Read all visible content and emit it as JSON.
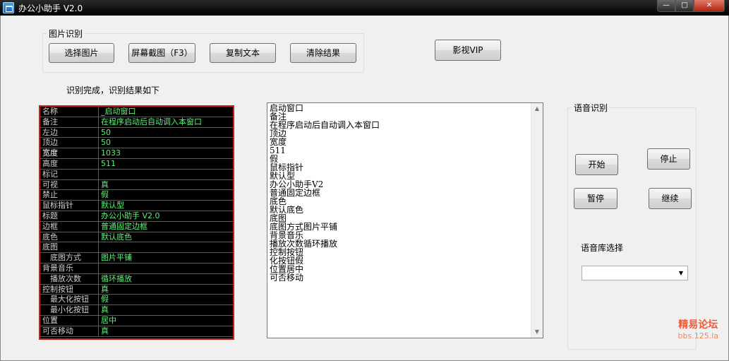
{
  "window": {
    "title": "办公小助手 V2.0",
    "minimize_glyph": "—",
    "maximize_glyph": "□",
    "close_glyph": "✕"
  },
  "image_group": {
    "title": "图片识别",
    "buttons": [
      "选择图片",
      "屏幕截图（F3）",
      "复制文本",
      "清除结果"
    ]
  },
  "vip_button": "影视VIP",
  "status_text": "识别完成，识别结果如下",
  "properties": [
    {
      "name": "名称",
      "value": "_启动窗口",
      "indent": false
    },
    {
      "name": "备注",
      "value": "在程序启动后自动调入本窗口",
      "indent": false
    },
    {
      "name": "左边",
      "value": "50",
      "indent": false
    },
    {
      "name": "顶边",
      "value": "50",
      "indent": false
    },
    {
      "name": "宽度",
      "value": "1033",
      "indent": false
    },
    {
      "name": "高度",
      "value": "511",
      "indent": false
    },
    {
      "name": "标记",
      "value": "",
      "indent": false
    },
    {
      "name": "可视",
      "value": "真",
      "indent": false
    },
    {
      "name": "禁止",
      "value": "假",
      "indent": false
    },
    {
      "name": "鼠标指针",
      "value": "默认型",
      "indent": false
    },
    {
      "name": "标题",
      "value": "办公小助手 V2.0",
      "indent": false
    },
    {
      "name": "边框",
      "value": "普通固定边框",
      "indent": false
    },
    {
      "name": "底色",
      "value": "默认底色",
      "indent": false
    },
    {
      "name": "底图",
      "value": "",
      "indent": false
    },
    {
      "name": "底图方式",
      "value": "图片平铺",
      "indent": true
    },
    {
      "name": "背景音乐",
      "value": "",
      "indent": false
    },
    {
      "name": "播放次数",
      "value": "循环播放",
      "indent": true
    },
    {
      "name": "控制按钮",
      "value": "真",
      "indent": false
    },
    {
      "name": "最大化按钮",
      "value": "假",
      "indent": true
    },
    {
      "name": "最小化按钮",
      "value": "真",
      "indent": true
    },
    {
      "name": "位置",
      "value": "居中",
      "indent": false
    },
    {
      "name": "可否移动",
      "value": "真",
      "indent": false
    }
  ],
  "result_lines": [
    "启动窗口",
    "备注",
    "在程序启动后自动调入本窗口",
    "顶边",
    "宽度",
    "511",
    "假",
    "鼠标指针",
    "默认型",
    "办公小助手V2",
    "普通固定边框",
    "底色",
    "默认底色",
    "底图",
    "底图方式图片平铺",
    "背景音乐",
    "播放次数循环播放",
    "控制按钮",
    "化按钮假",
    "位置居中",
    "可否移动"
  ],
  "speech_group": {
    "title": "语音识别",
    "start": "开始",
    "stop": "停止",
    "pause": "暂停",
    "resume": "继续",
    "library_label": "语音库选择",
    "library_value": ""
  },
  "watermark": {
    "line1": "精易论坛",
    "line2": "bbs.125.la"
  }
}
